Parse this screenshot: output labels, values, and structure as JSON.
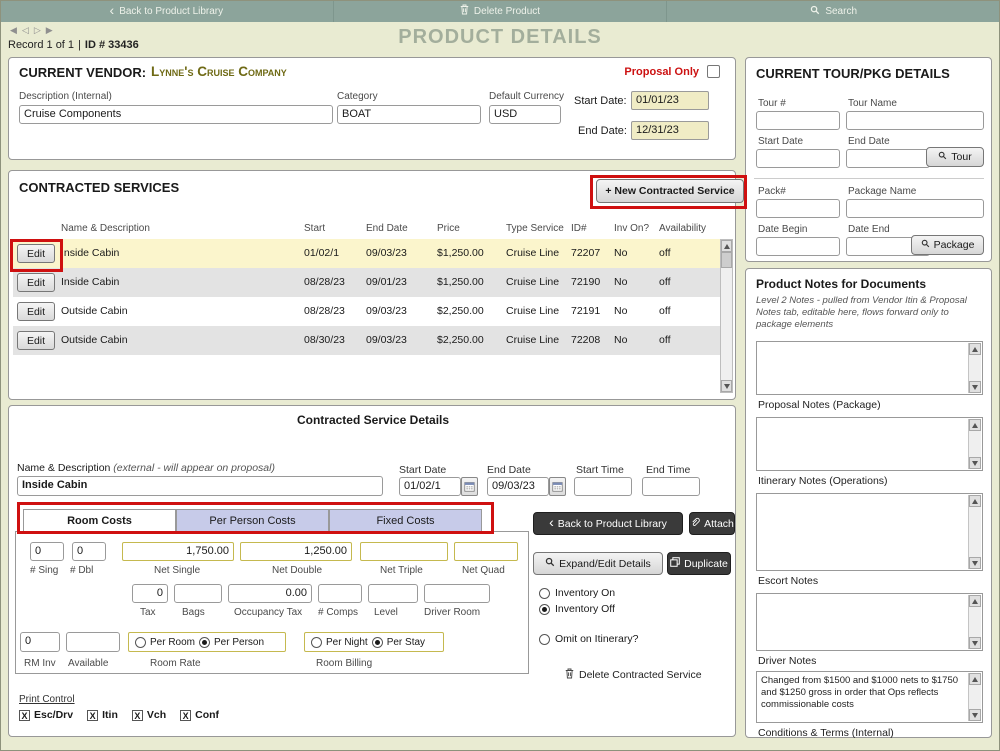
{
  "colors": {
    "toolbar_green": "#8ca49b",
    "page_bg": "#e9ebd2",
    "highlight_tan": "#f0ecc5",
    "row_highlight": "#fbf5cc",
    "tab_lavender": "#c7cbe9",
    "annotation_red": "#cf1010",
    "vendor_gold": "#6f6a15",
    "proposal_red": "#cc1111",
    "title_gray_green": "#a3ae9c"
  },
  "icons": {
    "back_chevron": "‹",
    "nav_first": "◀",
    "nav_prev": "◁",
    "nav_next": "▷",
    "nav_last": "▶",
    "check_x": "X"
  },
  "toolbar": {
    "back_label": "Back to Product Library",
    "delete_label": "Delete Product",
    "search_label": "Search"
  },
  "record_bar": {
    "record_text": "Record 1 of 1",
    "separator": "|",
    "id_text": "ID # 33436",
    "title": "PRODUCT DETAILS"
  },
  "vendor_panel": {
    "label": "CURRENT VENDOR:",
    "vendor_name": "Lynne's Cruise Company",
    "proposal_only_label": "Proposal Only",
    "description_label": "Description (Internal)",
    "description_value": "Cruise Components",
    "category_label": "Category",
    "category_value": "BOAT",
    "currency_label": "Default Currency",
    "currency_value": "USD",
    "start_date_label": "Start Date:",
    "start_date_value": "01/01/23",
    "end_date_label": "End Date:",
    "end_date_value": "12/31/23"
  },
  "services_panel": {
    "title": "CONTRACTED SERVICES",
    "new_service_label": "+ New Contracted Service",
    "edit_label": "Edit",
    "columns": [
      "Name & Description",
      "Start",
      "End Date",
      "Price",
      "Type Service",
      "ID#",
      "Inv On?",
      "Availability"
    ],
    "rows": [
      {
        "name": "Inside Cabin",
        "start": "01/02/1",
        "end_date": "09/03/23",
        "price": "$1,250.00",
        "type": "Cruise Line",
        "id": "72207",
        "inv_on": "No",
        "availability": "off"
      },
      {
        "name": "Inside Cabin",
        "start": "08/28/23",
        "end_date": "09/01/23",
        "price": "$1,250.00",
        "type": "Cruise Line",
        "id": "72190",
        "inv_on": "No",
        "availability": "off"
      },
      {
        "name": "Outside Cabin",
        "start": "08/28/23",
        "end_date": "09/03/23",
        "price": "$2,250.00",
        "type": "Cruise Line",
        "id": "72191",
        "inv_on": "No",
        "availability": "off"
      },
      {
        "name": "Outside Cabin",
        "start": "08/30/23",
        "end_date": "09/03/23",
        "price": "$2,250.00",
        "type": "Cruise Line",
        "id": "72208",
        "inv_on": "No",
        "availability": "off"
      }
    ]
  },
  "details_panel": {
    "title": "Contracted Service Details",
    "name_label": "Name & Description",
    "name_note": "(external - will appear on proposal)",
    "name_value": "Inside Cabin",
    "start_date_label": "Start Date",
    "start_date_value": "01/02/1",
    "end_date_label": "End Date",
    "end_date_value": "09/03/23",
    "start_time_label": "Start Time",
    "end_time_label": "End Time",
    "tabs": [
      "Room Costs",
      "Per Person Costs",
      "Fixed Costs"
    ],
    "costs": {
      "sing_value": "0",
      "sing_label": "# Sing",
      "dbl_value": "0",
      "dbl_label": "# Dbl",
      "net_single_value": "1,750.00",
      "net_single_label": "Net Single",
      "net_double_value": "1,250.00",
      "net_double_label": "Net Double",
      "net_triple_label": "Net Triple",
      "net_quad_label": "Net Quad",
      "tax_value": "0",
      "tax_label": "Tax",
      "bags_label": "Bags",
      "occupancy_value": "0.00",
      "occupancy_label": "Occupancy Tax",
      "comps_label": "# Comps",
      "level_label": "Level",
      "driver_room_label": "Driver Room",
      "rm_inv_value": "0",
      "rm_inv_label": "RM Inv",
      "available_label": "Available",
      "per_room_label": "Per Room",
      "per_person_label": "Per Person",
      "room_rate_label": "Room Rate",
      "per_night_label": "Per Night",
      "per_stay_label": "Per Stay",
      "room_billing_label": "Room Billing"
    },
    "side": {
      "back_label": "Back to Product Library",
      "attach_label": "Attach",
      "expand_label": "Expand/Edit Details",
      "duplicate_label": "Duplicate",
      "inventory_on_label": "Inventory On",
      "inventory_off_label": "Inventory Off",
      "omit_label": "Omit on Itinerary?",
      "delete_label": "Delete Contracted Service"
    },
    "print_control": {
      "title": "Print Control",
      "options": [
        "Esc/Drv",
        "Itin",
        "Vch",
        "Conf"
      ]
    }
  },
  "tour_panel": {
    "title": "CURRENT TOUR/PKG DETAILS",
    "tour_num_label": "Tour #",
    "tour_name_label": "Tour Name",
    "start_date_label": "Start Date",
    "end_date_label": "End Date",
    "tour_button_label": "Tour",
    "pack_num_label": "Pack#",
    "package_name_label": "Package Name",
    "date_begin_label": "Date Begin",
    "date_end_label": "Date End",
    "package_button_label": "Package"
  },
  "notes_panel": {
    "title": "Product Notes for Documents",
    "description": "Level 2 Notes - pulled from Vendor Itin & Proposal Notes tab, editable here, flows forward only to package elements",
    "sections": [
      {
        "label": "Proposal Notes (Package)",
        "value": ""
      },
      {
        "label": "Itinerary Notes (Operations)",
        "value": ""
      },
      {
        "label": "Escort Notes",
        "value": ""
      },
      {
        "label": "Driver Notes",
        "value": ""
      },
      {
        "label": "Conditions & Terms (Internal)",
        "value": "Changed from $1500 and $1000 nets to $1750 and $1250 gross in order that Ops reflects commissionable costs"
      }
    ]
  }
}
